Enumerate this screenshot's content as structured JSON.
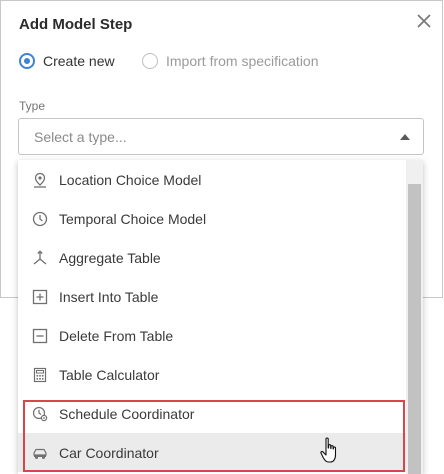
{
  "dialog": {
    "title": "Add Model Step",
    "options": [
      {
        "label": "Create new",
        "selected": true
      },
      {
        "label": "Import from specification",
        "selected": false
      }
    ],
    "type_label": "Type",
    "type_placeholder": "Select a type..."
  },
  "menu": {
    "items": [
      {
        "label": "Location Choice Model",
        "icon": "location-pin-icon"
      },
      {
        "label": "Temporal Choice Model",
        "icon": "clock-icon"
      },
      {
        "label": "Aggregate Table",
        "icon": "aggregate-icon"
      },
      {
        "label": "Insert Into Table",
        "icon": "plus-box-icon"
      },
      {
        "label": "Delete From Table",
        "icon": "minus-box-icon"
      },
      {
        "label": "Table Calculator",
        "icon": "calculator-icon"
      },
      {
        "label": "Schedule Coordinator",
        "icon": "clock-gear-icon"
      },
      {
        "label": "Car Coordinator",
        "icon": "car-icon"
      }
    ]
  },
  "colors": {
    "accent": "#3d82d8",
    "highlight": "#d9454d"
  }
}
